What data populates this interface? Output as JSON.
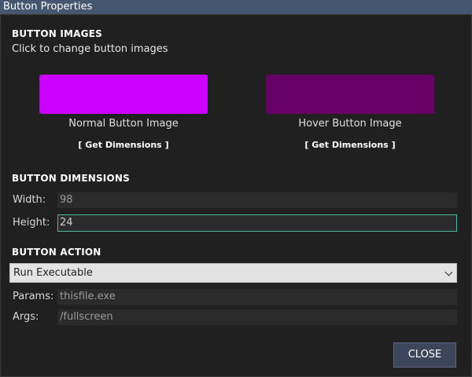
{
  "window": {
    "title": "Button Properties"
  },
  "images": {
    "heading": "BUTTON IMAGES",
    "subtitle": "Click to change button images",
    "normal": {
      "label": "Normal Button Image",
      "color": "#cc00ff",
      "get_dimensions": "[ Get Dimensions ]"
    },
    "hover": {
      "label": "Hover Button Image",
      "color": "#660066",
      "get_dimensions": "[ Get Dimensions ]"
    }
  },
  "dimensions": {
    "heading": "BUTTON DIMENSIONS",
    "width_label": "Width:",
    "width_value": "98",
    "height_label": "Height:",
    "height_value": "24"
  },
  "action": {
    "heading": "BUTTON ACTION",
    "selected": "Run Executable",
    "params_label": "Params:",
    "params_value": "thisfile.exe",
    "args_label": "Args:",
    "args_value": "/fullscreen"
  },
  "buttons": {
    "close": "CLOSE"
  },
  "colors": {
    "titlebar": "#44576e",
    "background": "#202020",
    "focus_border": "#4fb8a4",
    "close_bg": "#3b465a"
  }
}
